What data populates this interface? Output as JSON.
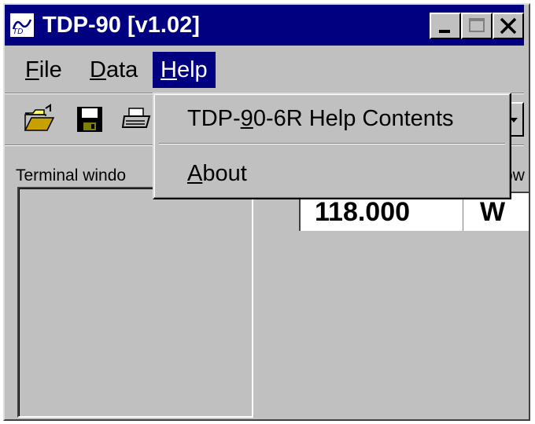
{
  "window": {
    "title": "TDP-90 [v1.02]",
    "icon": "app-icon",
    "controls": [
      "minimize-icon",
      "maximize-icon",
      "close-icon"
    ]
  },
  "menubar": {
    "items": [
      {
        "label": "File",
        "underline": "F"
      },
      {
        "label": "Data",
        "underline": "D"
      },
      {
        "label": "Help",
        "underline": "H",
        "active": true
      }
    ]
  },
  "toolbar": {
    "buttons": [
      "open-folder-icon",
      "save-disk-icon",
      "print-icon"
    ]
  },
  "help_menu": {
    "items": [
      {
        "label_pre": "TDP-",
        "label_mnemonic": "9",
        "label_post": "0-6R Help Contents"
      },
      {
        "label_pre": "",
        "label_mnemonic": "A",
        "label_post": "bout"
      }
    ]
  },
  "main": {
    "terminal_label": "Terminal windo",
    "right_label": "ow",
    "readout_value": "118.000",
    "readout_unit": "W"
  },
  "colors": {
    "titlebar": "#000080",
    "face": "#c0c0c0",
    "active_menu": "#000080"
  }
}
